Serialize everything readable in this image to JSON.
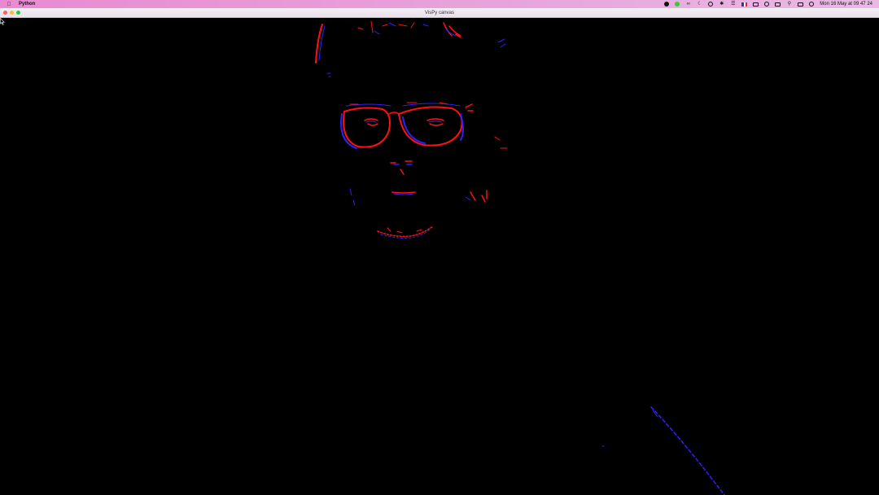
{
  "menubar": {
    "app_name": "Python",
    "clock": "Mon 16 May at  09 47 24",
    "icons": [
      "apple-icon",
      "record-icon",
      "check-icon",
      "glasses-icon",
      "moon-icon",
      "history-icon",
      "bluetooth-icon",
      "wifi-icon",
      "flag-fr-icon",
      "keyboard-icon",
      "user-icon",
      "battery-icon",
      "search-icon",
      "control-center-icon",
      "siri-icon"
    ]
  },
  "window": {
    "title": "VisPy canvas"
  },
  "colors": {
    "close": "#fe5f57",
    "minimize": "#febc2e",
    "maximize": "#28c840",
    "event_positive": "#ff1010",
    "event_negative": "#3020ff"
  }
}
